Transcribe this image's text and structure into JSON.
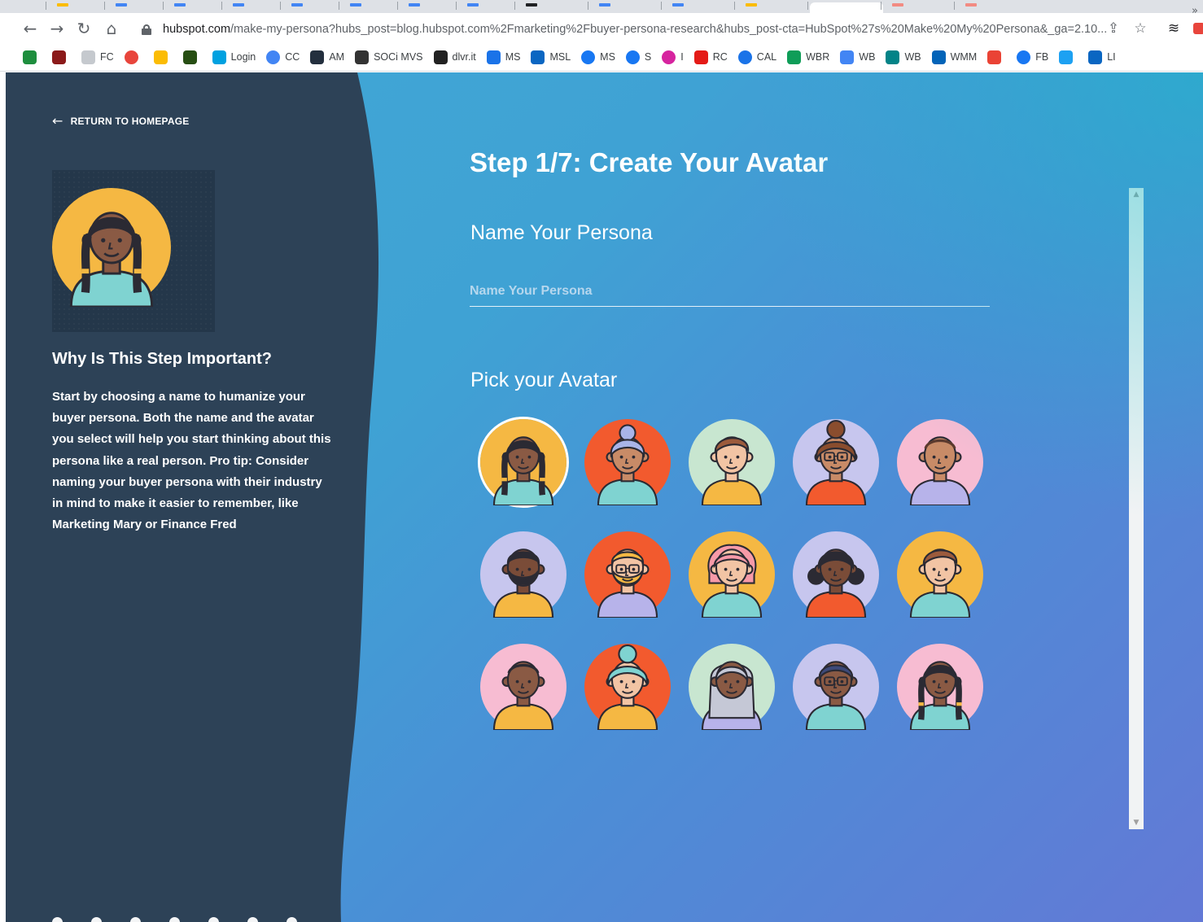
{
  "browser": {
    "url_host": "hubspot.com",
    "url_rest": "/make-my-persona?hubs_post=blog.hubspot.com%2Fmarketing%2Fbuyer-persona-research&hubs_post-cta=HubSpot%27s%20Make%20My%20Persona&_ga=2.10...",
    "nav_icons": [
      "back-arrow-icon",
      "forward-arrow-icon",
      "reload-icon",
      "home-icon"
    ],
    "right_icons": [
      "share-icon",
      "star-icon",
      "extension-layers-icon",
      "extension-red-icon"
    ],
    "bookmarks": [
      {
        "label": "",
        "icon": "green-stack-icon",
        "color": "#1e8e3e"
      },
      {
        "label": "",
        "icon": "red-square-icon",
        "color": "#8b1a1a"
      },
      {
        "label": "FC",
        "icon": "file-icon",
        "color": "#c5c9ce"
      },
      {
        "label": "",
        "icon": "chrome-color-icon",
        "color": "#e8453c"
      },
      {
        "label": "",
        "icon": "yellow-square-icon",
        "color": "#fbbc04"
      },
      {
        "label": "",
        "icon": "dark-green-icon",
        "color": "#274e13"
      },
      {
        "label": "Login",
        "icon": "salesforce-cloud-icon",
        "color": "#00a1e0"
      },
      {
        "label": "CC",
        "icon": "cc-swirl-icon",
        "color": "#4285f4"
      },
      {
        "label": "AM",
        "icon": "amazon-icon",
        "color": "#232f3e"
      },
      {
        "label": "SOCi MVS",
        "icon": "soci-icon",
        "color": "#333333"
      },
      {
        "label": "dlvr.it",
        "icon": "dlvr-icon",
        "color": "#222222"
      },
      {
        "label": "MS",
        "icon": "s-blue-icon",
        "color": "#1a73e8"
      },
      {
        "label": "MSL",
        "icon": "linkedin-icon",
        "color": "#0a66c2"
      },
      {
        "label": "MS",
        "icon": "facebook-icon",
        "color": "#1877f2"
      },
      {
        "label": "S",
        "icon": "facebook-icon",
        "color": "#1877f2"
      },
      {
        "label": "I",
        "icon": "instagram-icon",
        "color": "#d6249f"
      },
      {
        "label": "RC",
        "icon": "red-cross-icon",
        "color": "#e41b17"
      },
      {
        "label": "CAL",
        "icon": "blue-circle-icon",
        "color": "#1a73e8"
      },
      {
        "label": "WBR",
        "icon": "green-plus-icon",
        "color": "#0f9d58"
      },
      {
        "label": "WB",
        "icon": "docs-icon",
        "color": "#4285f4"
      },
      {
        "label": "WB",
        "icon": "sharepoint-icon",
        "color": "#038387"
      },
      {
        "label": "WMM",
        "icon": "outlook-icon",
        "color": "#0364b8"
      },
      {
        "label": "",
        "icon": "gmail-icon",
        "color": "#ea4335"
      },
      {
        "label": "FB",
        "icon": "facebook-icon",
        "color": "#1877f2"
      },
      {
        "label": "",
        "icon": "twitter-icon",
        "color": "#1da1f2"
      },
      {
        "label": "LI",
        "icon": "linkedin-icon",
        "color": "#0a66c2"
      }
    ],
    "bookmarks_overflow": "»"
  },
  "sidebar": {
    "return_label": "RETURN TO HOMEPAGE",
    "why_title": "Why Is This Step Important?",
    "why_body": "Start by choosing a name to humanize your buyer persona. Both the name and the avatar you select will help you start thinking about this persona like a real person. Pro tip: Consider naming your buyer persona with their industry in mind to make it easier to remember, like Marketing Mary or Finance Fred",
    "progress_steps": 7,
    "panel_color": "#2d4257"
  },
  "main": {
    "step_title": "Step 1/7: Create Your Avatar",
    "name_heading": "Name Your Persona",
    "name_input": {
      "value": "",
      "placeholder": "Name Your Persona"
    },
    "avatar_heading": "Pick your Avatar",
    "selected_avatar": 0,
    "avatars": [
      {
        "bg": "#f5b843",
        "skin": "#8a5a44",
        "hair": "#2b2a33",
        "shirt": "#7fd3d1",
        "style": "braids"
      },
      {
        "bg": "#f25a2e",
        "skin": "#c88b67",
        "hair": "#a9b4e8",
        "shirt": "#7fd3d1",
        "style": "bun-top"
      },
      {
        "bg": "#c8e6d0",
        "skin": "#f2c4a4",
        "hair": "#9c5b3c",
        "shirt": "#f5b843",
        "style": "short"
      },
      {
        "bg": "#c7c6ee",
        "skin": "#c88b67",
        "hair": "#8a4d2e",
        "shirt": "#f25a2e",
        "style": "curly-bun-glasses"
      },
      {
        "bg": "#f7bcd2",
        "skin": "#c88b67",
        "hair": "#5c3a2e",
        "shirt": "#b7b3ea",
        "style": "bald"
      },
      {
        "bg": "#c7c6ee",
        "skin": "#7a4c38",
        "hair": "#2b2a33",
        "shirt": "#f5b843",
        "style": "beard"
      },
      {
        "bg": "#f25a2e",
        "skin": "#f2c4a4",
        "hair": "#f5b843",
        "shirt": "#b7b3ea",
        "style": "beard-glasses"
      },
      {
        "bg": "#f5b843",
        "skin": "#f2c4a4",
        "hair": "#f79aa8",
        "shirt": "#7fd3d1",
        "style": "curly"
      },
      {
        "bg": "#c7c6ee",
        "skin": "#7a4c38",
        "hair": "#2b2a33",
        "shirt": "#f25a2e",
        "style": "afro-puffs"
      },
      {
        "bg": "#f5b843",
        "skin": "#f2c4a4",
        "hair": "#9c5b3c",
        "shirt": "#7fd3d1",
        "style": "short"
      },
      {
        "bg": "#f7bcd2",
        "skin": "#8a5a44",
        "hair": "#2b2a33",
        "shirt": "#f5b843",
        "style": "bald"
      },
      {
        "bg": "#f25a2e",
        "skin": "#f2c4a4",
        "hair": "#7fd3d1",
        "shirt": "#f5b843",
        "style": "curly-bun"
      },
      {
        "bg": "#c8e6d0",
        "skin": "#8a5a44",
        "hair": "#c5c8d6",
        "shirt": "#b7b3ea",
        "style": "long"
      },
      {
        "bg": "#c7c6ee",
        "skin": "#8a5a44",
        "hair": "#3d4a7a",
        "shirt": "#7fd3d1",
        "style": "glasses-short"
      },
      {
        "bg": "#f7bcd2",
        "skin": "#8a5a44",
        "hair": "#2b2a33",
        "shirt": "#7fd3d1",
        "style": "braids"
      }
    ]
  },
  "colors": {
    "accent_white": "#ffffff",
    "panel_dark": "#2d4257",
    "gradient_start": "#42a8d6",
    "gradient_end": "#6379d6"
  }
}
